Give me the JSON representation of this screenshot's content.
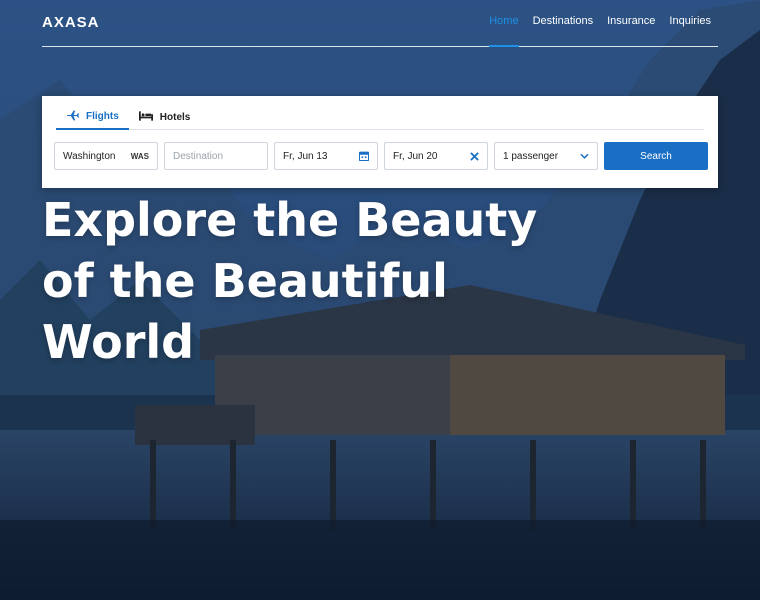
{
  "brand": {
    "logo": "AXASA"
  },
  "nav": {
    "items": [
      {
        "label": "Home",
        "active": true
      },
      {
        "label": "Destinations",
        "active": false
      },
      {
        "label": "Insurance",
        "active": false
      },
      {
        "label": "Inquiries",
        "active": false
      }
    ]
  },
  "booking": {
    "tabs": [
      {
        "label": "Flights",
        "icon": "airplane-icon",
        "active": true
      },
      {
        "label": "Hotels",
        "icon": "bed-icon",
        "active": false
      }
    ],
    "origin": {
      "value": "Washington",
      "code": "WAS"
    },
    "destination": {
      "placeholder": "Destination",
      "value": ""
    },
    "depart_date": {
      "value": "Fr, Jun 13",
      "icon": "calendar-icon"
    },
    "return_date": {
      "value": "Fr, Jun 20",
      "icon": "close-icon"
    },
    "passengers": {
      "value": "1 passenger",
      "icon": "chevron-down-icon"
    },
    "search_label": "Search"
  },
  "hero": {
    "line1": "Explore the Beauty",
    "line2": "of the Beautiful",
    "line3": "World"
  },
  "colors": {
    "accent": "#1a6fc4",
    "nav_active": "#1e90e6"
  }
}
